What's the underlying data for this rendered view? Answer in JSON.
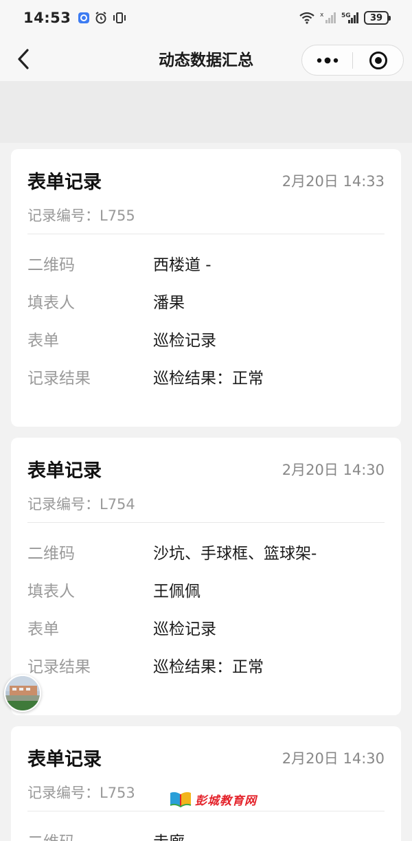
{
  "status_bar": {
    "time": "14:53",
    "battery": "39",
    "network": "5G"
  },
  "nav": {
    "title": "动态数据汇总",
    "back_icon": "chevron-left-icon",
    "more_icon": "more-dots-icon",
    "close_icon": "target-icon"
  },
  "labels": {
    "qrcode": "二维码",
    "filler": "填表人",
    "form": "表单",
    "result": "记录结果"
  },
  "records": [
    {
      "title": "表单记录",
      "time": "2月20日 14:33",
      "record_no": "记录编号：L755",
      "qrcode": "西楼道 -",
      "filler": "潘果",
      "form": "巡检记录",
      "result": "巡检结果：正常"
    },
    {
      "title": "表单记录",
      "time": "2月20日 14:30",
      "record_no": "记录编号：L754",
      "qrcode": "沙坑、手球框、篮球架-",
      "filler": "王佩佩",
      "form": "巡检记录",
      "result": "巡检结果：正常"
    },
    {
      "title": "表单记录",
      "time": "2月20日 14:30",
      "record_no": "记录编号：L753",
      "qrcode": "走廊 -"
    }
  ],
  "watermark": {
    "text": "彭城教育网"
  },
  "colors": {
    "background": "#f2f2f2",
    "card": "#ffffff",
    "label": "#9a9a9a",
    "watermark": "#e4232b"
  }
}
